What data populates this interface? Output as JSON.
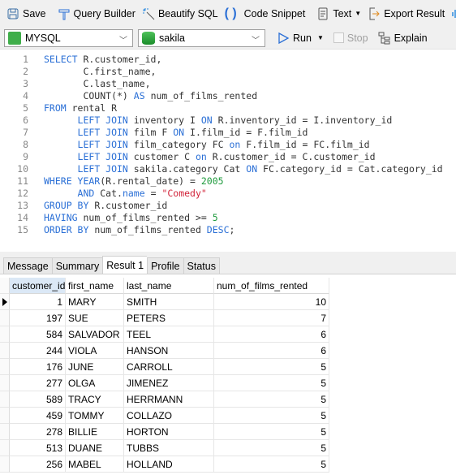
{
  "toolbar": {
    "save": "Save",
    "query_builder": "Query Builder",
    "beautify": "Beautify SQL",
    "code_snippet": "Code Snippet",
    "text": "Text",
    "export": "Export Result"
  },
  "connection": {
    "type": "MYSQL",
    "database": "sakila",
    "run": "Run",
    "stop": "Stop",
    "explain": "Explain"
  },
  "colors": {
    "keyword": "#2a6fd6",
    "string": "#d2243a",
    "number": "#1d9a3c"
  },
  "editor": {
    "lines": [
      [
        [
          "k",
          "SELECT"
        ],
        [
          "p",
          " R.customer_id,"
        ]
      ],
      [
        [
          "p",
          "       C.first_name,"
        ]
      ],
      [
        [
          "p",
          "       C.last_name,"
        ]
      ],
      [
        [
          "p",
          "       COUNT(*) "
        ],
        [
          "k",
          "AS"
        ],
        [
          "p",
          " num_of_films_rented"
        ]
      ],
      [
        [
          "k",
          "FROM"
        ],
        [
          "p",
          " rental R"
        ]
      ],
      [
        [
          "p",
          "      "
        ],
        [
          "k",
          "LEFT JOIN"
        ],
        [
          "p",
          " inventory I "
        ],
        [
          "k",
          "ON"
        ],
        [
          "p",
          " R.inventory_id = I.inventory_id"
        ]
      ],
      [
        [
          "p",
          "      "
        ],
        [
          "k",
          "LEFT JOIN"
        ],
        [
          "p",
          " film F "
        ],
        [
          "k",
          "ON"
        ],
        [
          "p",
          " I.film_id = F.film_id"
        ]
      ],
      [
        [
          "p",
          "      "
        ],
        [
          "k",
          "LEFT JOIN"
        ],
        [
          "p",
          " film_category FC "
        ],
        [
          "k",
          "on"
        ],
        [
          "p",
          " F.film_id = FC.film_id"
        ]
      ],
      [
        [
          "p",
          "      "
        ],
        [
          "k",
          "LEFT JOIN"
        ],
        [
          "p",
          " customer C "
        ],
        [
          "k",
          "on"
        ],
        [
          "p",
          " R.customer_id = C.customer_id"
        ]
      ],
      [
        [
          "p",
          "      "
        ],
        [
          "k",
          "LEFT JOIN"
        ],
        [
          "p",
          " sakila.category Cat "
        ],
        [
          "k",
          "ON"
        ],
        [
          "p",
          " FC.category_id = Cat.category_id"
        ]
      ],
      [
        [
          "k",
          "WHERE YEAR"
        ],
        [
          "p",
          "(R.rental_date) = "
        ],
        [
          "n",
          "2005"
        ]
      ],
      [
        [
          "p",
          "      "
        ],
        [
          "k",
          "AND"
        ],
        [
          "p",
          " Cat."
        ],
        [
          "k",
          "name"
        ],
        [
          "p",
          " = "
        ],
        [
          "s",
          "\"Comedy\""
        ]
      ],
      [
        [
          "k",
          "GROUP BY"
        ],
        [
          "p",
          " R.customer_id"
        ]
      ],
      [
        [
          "k",
          "HAVING"
        ],
        [
          "p",
          " num_of_films_rented >= "
        ],
        [
          "n",
          "5"
        ]
      ],
      [
        [
          "k",
          "ORDER BY"
        ],
        [
          "p",
          " num_of_films_rented "
        ],
        [
          "k",
          "DESC"
        ],
        [
          "p",
          ";"
        ]
      ]
    ]
  },
  "result_tabs": [
    "Message",
    "Summary",
    "Result 1",
    "Profile",
    "Status"
  ],
  "active_tab": "Result 1",
  "grid": {
    "columns": [
      "customer_id",
      "first_name",
      "last_name",
      "num_of_films_rented"
    ],
    "rows": [
      [
        "1",
        "MARY",
        "SMITH",
        "10"
      ],
      [
        "197",
        "SUE",
        "PETERS",
        "7"
      ],
      [
        "584",
        "SALVADOR",
        "TEEL",
        "6"
      ],
      [
        "244",
        "VIOLA",
        "HANSON",
        "6"
      ],
      [
        "176",
        "JUNE",
        "CARROLL",
        "5"
      ],
      [
        "277",
        "OLGA",
        "JIMENEZ",
        "5"
      ],
      [
        "589",
        "TRACY",
        "HERRMANN",
        "5"
      ],
      [
        "459",
        "TOMMY",
        "COLLAZO",
        "5"
      ],
      [
        "278",
        "BILLIE",
        "HORTON",
        "5"
      ],
      [
        "513",
        "DUANE",
        "TUBBS",
        "5"
      ],
      [
        "256",
        "MABEL",
        "HOLLAND",
        "5"
      ]
    ]
  }
}
